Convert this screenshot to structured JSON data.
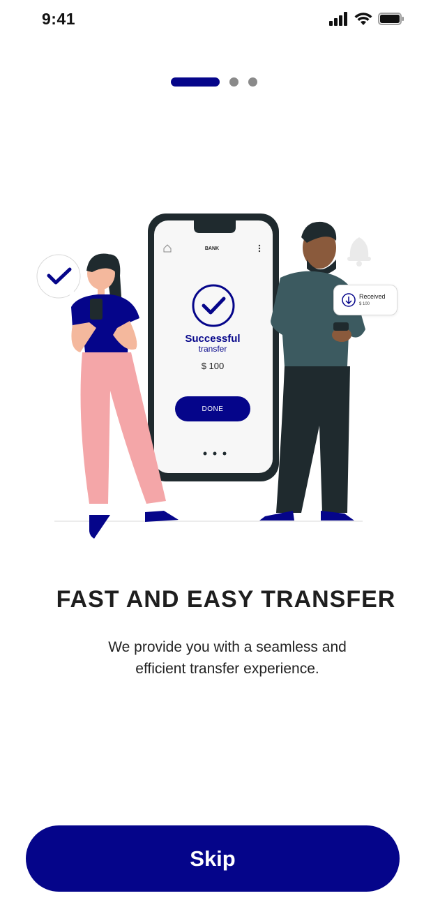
{
  "status_bar": {
    "time": "9:41"
  },
  "pager": {
    "total": 3,
    "active_index": 0
  },
  "illustration": {
    "bank_label": "BANK",
    "success_title": "Successful",
    "success_subtitle": "transfer",
    "amount": "$ 100",
    "done_label": "DONE",
    "received_title": "Received",
    "received_amount": "$ 100"
  },
  "onboarding": {
    "title": "FAST AND EASY TRANSFER",
    "description_line1": "We provide you with a seamless and",
    "description_line2": "efficient transfer experience."
  },
  "skip_label": "Skip",
  "colors": {
    "brand": "#05058a",
    "pant_pink": "#f4a6a8",
    "shirt_teal": "#3c5a60",
    "dark": "#1f2a2e"
  }
}
